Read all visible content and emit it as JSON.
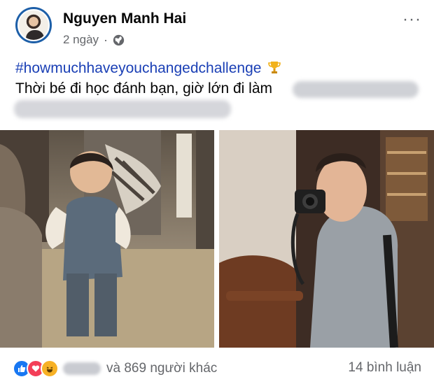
{
  "post": {
    "author": "Nguyen Manh Hai",
    "time": "2 ngày",
    "separator": "·",
    "hashtag": "#howmuchhaveyouchangedchallenge",
    "text": "Thời bé đi học đánh bạn, giờ lớn đi làm",
    "more": "···"
  },
  "reactions": {
    "summary": "và 869 người khác",
    "comments": "14 bình luận",
    "types": [
      "like-icon",
      "love-icon",
      "haha-icon"
    ]
  },
  "colors": {
    "hashtag": "#1a3fb5",
    "meta": "#65676b",
    "like": "#1877f2",
    "love": "#f33e58",
    "haha": "#f7b125"
  }
}
